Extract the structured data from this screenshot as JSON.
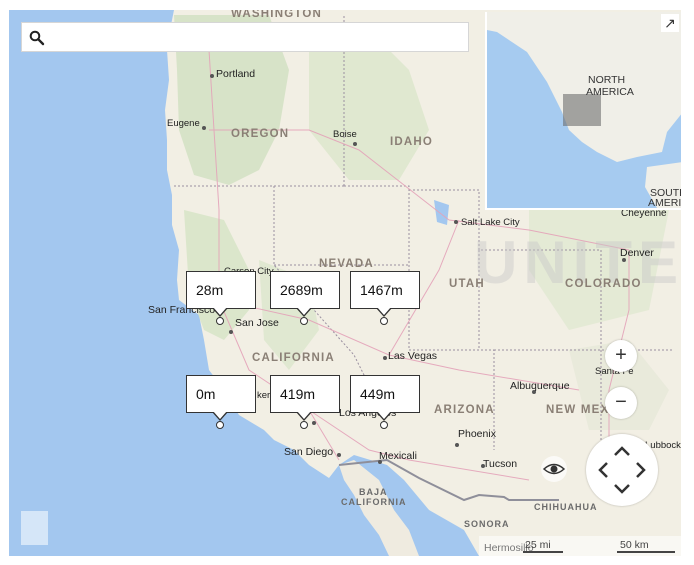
{
  "search": {
    "placeholder": ""
  },
  "states": {
    "oregon": "OREGON",
    "idaho": "IDAHO",
    "nevada": "NEVADA",
    "utah": "UTAH",
    "colorado": "COLORADO",
    "california": "CALIFORNIA",
    "arizona": "ARIZONA",
    "new_mexico": "NEW MEX",
    "washington": "WASHINGTON",
    "baja": "BAJA",
    "baja2": "CALIFORNIA",
    "chihuahua": "CHIHUAHUA",
    "sonora": "SONORA",
    "united": "UNITE"
  },
  "cities": {
    "portland": "Portland",
    "eugene": "Eugene",
    "boise": "Boise",
    "salt_lake": "Salt Lake City",
    "cheyenne": "Cheyenne",
    "denver": "Denver",
    "carson": "Carson City",
    "sf": "San Francisco",
    "san_jose": "San Jose",
    "las_vegas": "Las Vegas",
    "santa_fe": "Santa Fe",
    "albuquerque": "Albuquerque",
    "los_angeles": "Los Angeles",
    "phoenix": "Phoenix",
    "tucson": "Tucson",
    "san_diego": "San Diego",
    "mexicali": "Mexicali",
    "lubbock": "Lubbock",
    "hermosillo": "Hermosillo",
    "bakersfield": "ker"
  },
  "overview": {
    "label_na1": "NORTH",
    "label_na2": "AMERICA",
    "label_south": "SOUTH",
    "label_america": "AMERICA",
    "label_colorado": "Colorado",
    "label_denver": "Denver"
  },
  "callouts": [
    {
      "label": "28m"
    },
    {
      "label": "2689m"
    },
    {
      "label": "1467m"
    },
    {
      "label": "0m"
    },
    {
      "label": "419m"
    },
    {
      "label": "449m"
    }
  ],
  "controls": {
    "zoom_in": "+",
    "zoom_out": "−",
    "expand": "↗"
  },
  "scale": {
    "miles": "25 mi",
    "km": "50 km"
  }
}
